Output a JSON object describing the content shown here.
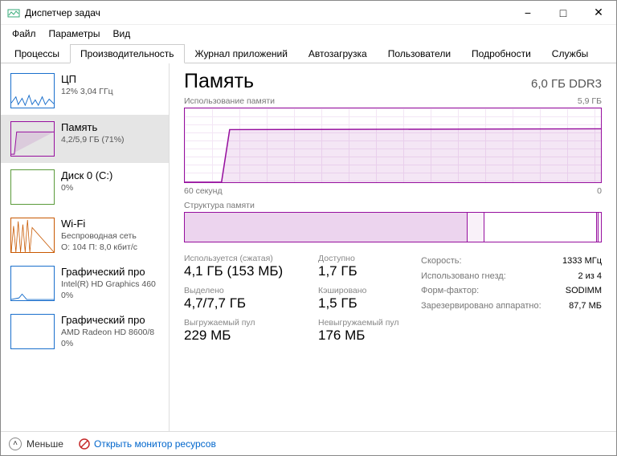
{
  "window": {
    "title": "Диспетчер задач"
  },
  "menu": {
    "file": "Файл",
    "options": "Параметры",
    "view": "Вид"
  },
  "tabs": {
    "processes": "Процессы",
    "performance": "Производительность",
    "apps": "Журнал приложений",
    "startup": "Автозагрузка",
    "users": "Пользователи",
    "details": "Подробности",
    "services": "Службы"
  },
  "sidebar": {
    "cpu": {
      "title": "ЦП",
      "sub": "12% 3,04 ГГц"
    },
    "memory": {
      "title": "Память",
      "sub": "4,2/5,9 ГБ (71%)"
    },
    "disk": {
      "title": "Диск 0 (C:)",
      "sub": "0%"
    },
    "wifi": {
      "title": "Wi-Fi",
      "sub1": "Беспроводная сеть",
      "sub2": "О: 104 П: 8,0 кбит/с"
    },
    "gpu0": {
      "title": "Графический про",
      "sub1": "Intel(R) HD Graphics 460",
      "sub2": "0%"
    },
    "gpu1": {
      "title": "Графический про",
      "sub1": "AMD Radeon HD 8600/8",
      "sub2": "0%"
    }
  },
  "detail": {
    "title": "Память",
    "subtitle": "6,0 ГБ DDR3",
    "usage_label": "Использование памяти",
    "usage_max": "5,9 ГБ",
    "xaxis_left": "60 секунд",
    "xaxis_right": "0",
    "composition_label": "Структура памяти"
  },
  "stats": {
    "used": {
      "label": "Используется (сжатая)",
      "value": "4,1 ГБ (153 МБ)"
    },
    "avail": {
      "label": "Доступно",
      "value": "1,7 ГБ"
    },
    "committed": {
      "label": "Выделено",
      "value": "4,7/7,7 ГБ"
    },
    "cached": {
      "label": "Кэшировано",
      "value": "1,5 ГБ"
    },
    "paged": {
      "label": "Выгружаемый пул",
      "value": "229 МБ"
    },
    "nonpaged": {
      "label": "Невыгружаемый пул",
      "value": "176 МБ"
    }
  },
  "right_stats": {
    "speed": {
      "k": "Скорость:",
      "v": "1333 МГц"
    },
    "slots": {
      "k": "Использовано гнезд:",
      "v": "2 из 4"
    },
    "form": {
      "k": "Форм-фактор:",
      "v": "SODIMM"
    },
    "reserved": {
      "k": "Зарезервировано аппаратно:",
      "v": "87,7 МБ"
    }
  },
  "footer": {
    "less": "Меньше",
    "resmon": "Открыть монитор ресурсов"
  },
  "chart_data": {
    "type": "line",
    "title": "Использование памяти",
    "xlabel": "60 секунд",
    "ylabel": "",
    "ylim": [
      0,
      5.9
    ],
    "x": [
      60,
      55,
      54,
      53,
      50,
      45,
      40,
      35,
      30,
      25,
      20,
      15,
      10,
      5,
      0
    ],
    "values": [
      0,
      0,
      4.1,
      4.2,
      4.2,
      4.2,
      4.2,
      4.2,
      4.2,
      4.2,
      4.2,
      4.2,
      4.2,
      4.2,
      4.2
    ],
    "composition_segments_percent": [
      68,
      4,
      27,
      0.5,
      0.5
    ]
  }
}
